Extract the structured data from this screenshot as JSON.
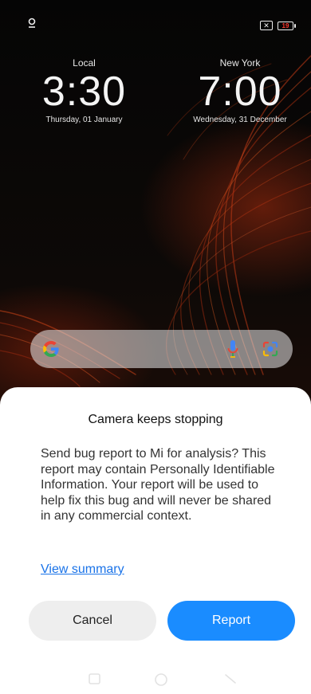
{
  "clocks": {
    "local": {
      "city": "Local",
      "time": "3:30",
      "date": "Thursday, 01 January"
    },
    "remote": {
      "city": "New York",
      "time": "7:00",
      "date": "Wednesday, 31 December"
    }
  },
  "status": {
    "battery": "19",
    "sim_icon": "no-sim-icon",
    "left_icon": "location-pin-icon"
  },
  "search": {
    "google_icon": "google-g-icon",
    "mic_icon": "microphone-icon",
    "lens_icon": "lens-icon"
  },
  "dialog": {
    "title": "Camera keeps stopping",
    "message": "Send bug report to Mi for analysis? This report may contain Personally Identifiable Information. Your report will be used to help fix this bug and will never be shared in any commercial context.",
    "link": "View summary",
    "cancel": "Cancel",
    "report": "Report"
  },
  "colors": {
    "report_button": "#1a8cff",
    "link": "#1a73e8",
    "battery_low": "#ff3b30"
  }
}
